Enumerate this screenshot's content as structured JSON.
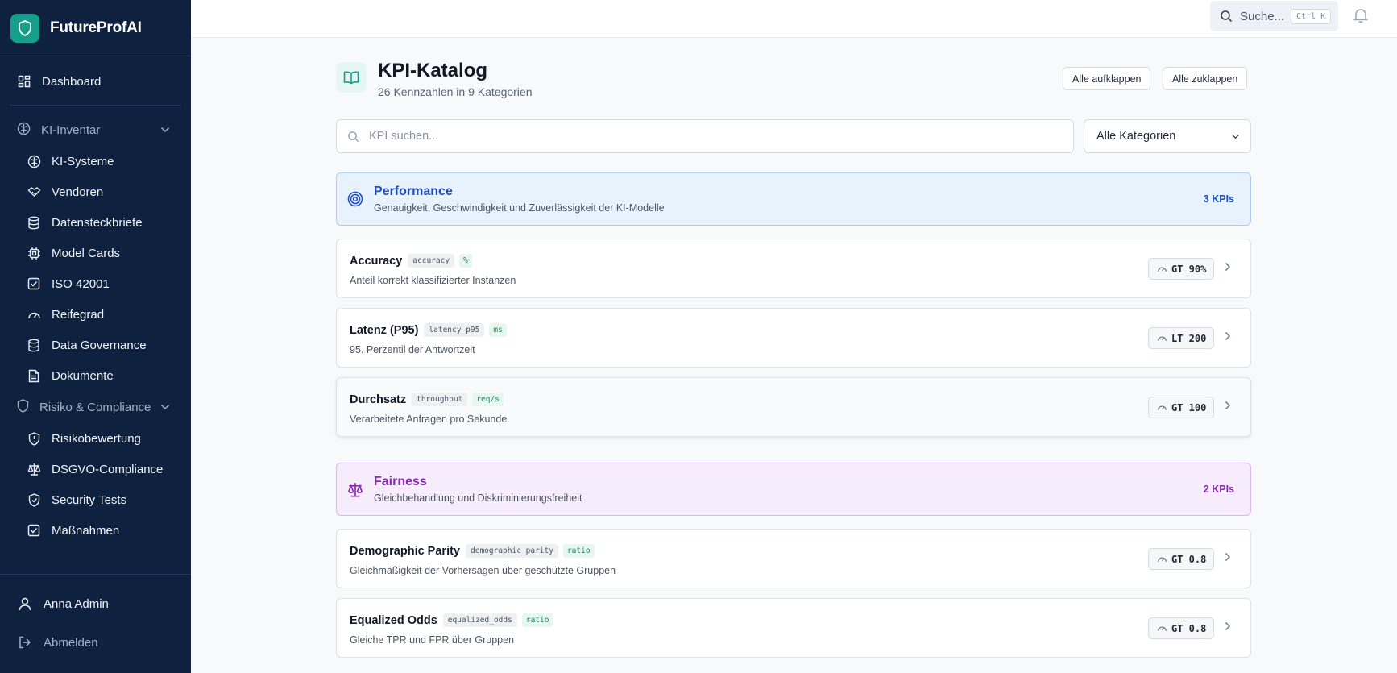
{
  "app": {
    "name": "FutureProfAI"
  },
  "sidebar": {
    "dashboard": "Dashboard",
    "groups": [
      {
        "label": "KI-Inventar",
        "items": [
          "KI-Systeme",
          "Vendoren",
          "Datensteckbriefe",
          "Model Cards",
          "ISO 42001",
          "Reifegrad",
          "Data Governance",
          "Dokumente"
        ]
      },
      {
        "label": "Risiko & Compliance",
        "items": [
          "Risikobewertung",
          "DSGVO-Compliance",
          "Security Tests",
          "Maßnahmen"
        ]
      }
    ],
    "user": "Anna Admin",
    "logout": "Abmelden"
  },
  "topbar": {
    "search_label": "Suche...",
    "shortcut": "Ctrl K"
  },
  "page": {
    "title": "KPI-Katalog",
    "subtitle": "26 Kennzahlen in 9 Kategorien",
    "expand_all": "Alle aufklappen",
    "collapse_all": "Alle zuklappen",
    "search_placeholder": "KPI suchen...",
    "category_filter": "Alle Kategorien"
  },
  "categories": [
    {
      "name": "Performance",
      "description": "Genauigkeit, Geschwindigkeit und Zuverlässigkeit der KI-Modelle",
      "count": "3 KPIs",
      "color": "#1f4fbf",
      "kpis": [
        {
          "name": "Accuracy",
          "code": "accuracy",
          "unit": "%",
          "description": "Anteil korrekt klassifizierter Instanzen",
          "target": "GT 90%"
        },
        {
          "name": "Latenz (P95)",
          "code": "latency_p95",
          "unit": "ms",
          "description": "95. Perzentil der Antwortzeit",
          "target": "LT 200"
        },
        {
          "name": "Durchsatz",
          "code": "throughput",
          "unit": "req/s",
          "description": "Verarbeitete Anfragen pro Sekunde",
          "target": "GT 100"
        }
      ]
    },
    {
      "name": "Fairness",
      "description": "Gleichbehandlung und Diskriminierungsfreiheit",
      "count": "2 KPIs",
      "color": "#8a2bb3",
      "kpis": [
        {
          "name": "Demographic Parity",
          "code": "demographic_parity",
          "unit": "ratio",
          "description": "Gleichmäßigkeit der Vorhersagen über geschützte Gruppen",
          "target": "GT 0.8"
        },
        {
          "name": "Equalized Odds",
          "code": "equalized_odds",
          "unit": "ratio",
          "description": "Gleiche TPR und FPR über Gruppen",
          "target": "GT 0.8"
        }
      ]
    }
  ]
}
